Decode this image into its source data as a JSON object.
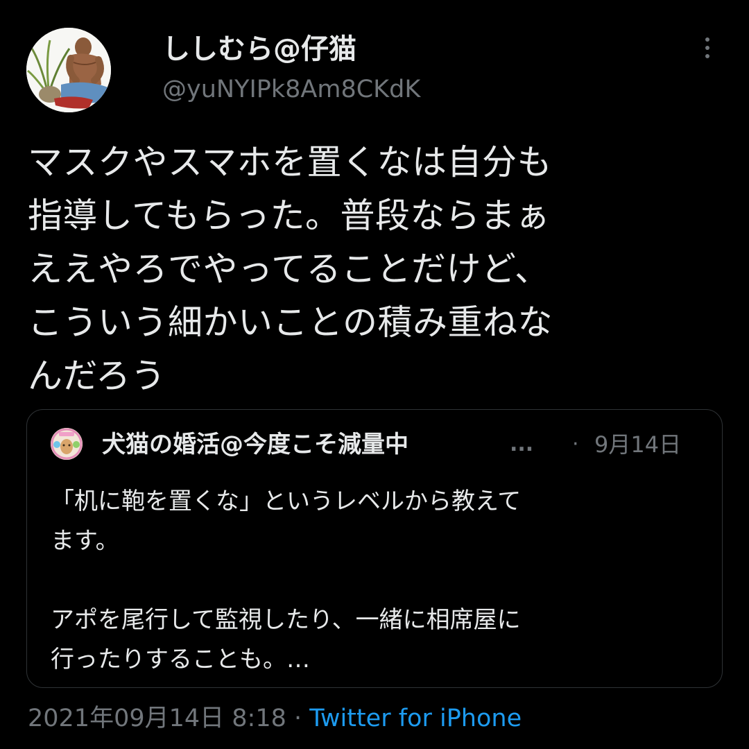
{
  "author": {
    "display_name": "ししむら@仔猫",
    "handle": "@yuNYIPk8Am8CKdK"
  },
  "tweet": {
    "text": "マスクやスマホを置くなは自分も\n指導してもらった。普段ならまぁ\nええやろでやってることだけど、\nこういう細かいことの積み重ねな\nんだろう",
    "timestamp": "2021年09月14日 8:18",
    "separator": "·",
    "source": "Twitter for iPhone"
  },
  "quote": {
    "display_name": "犬猫の婚活@今度こそ減量中",
    "truncation": "...",
    "separator": "·",
    "date": "9月14日",
    "text": "「机に鞄を置くな」というレベルから教えて\nます。\n\nアポを尾行して監視したり、一緒に相席屋に\n行ったりすることも。…"
  },
  "icons": {
    "more": "more-vertical-icon",
    "avatar": "user-avatar",
    "quote_avatar": "quote-user-avatar"
  },
  "colors": {
    "background": "#000000",
    "text_primary": "#e7e9ea",
    "text_secondary": "#71767b",
    "link": "#1d9bf0",
    "border": "#2f3336"
  }
}
